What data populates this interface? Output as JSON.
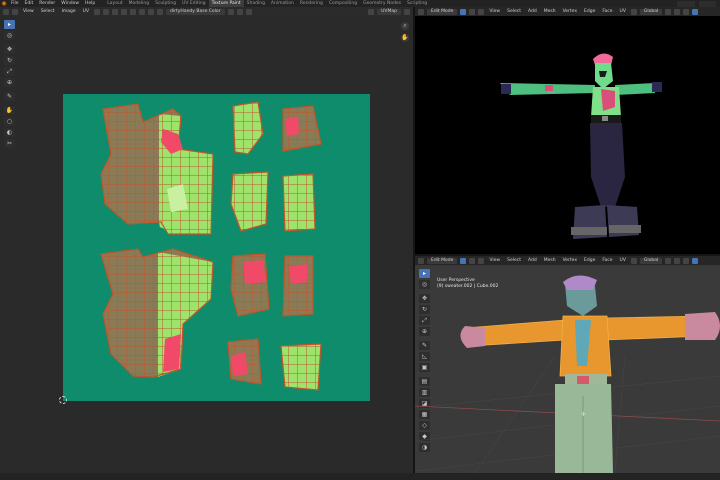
{
  "topbar": {
    "menus": [
      "File",
      "Edit",
      "Render",
      "Window",
      "Help"
    ],
    "tabs": [
      "Layout",
      "Modeling",
      "Sculpting",
      "UV Editing",
      "Texture Paint",
      "Shading",
      "Animation",
      "Rendering",
      "Compositing",
      "Geometry Nodes",
      "Scripting"
    ],
    "active_tab": "Texture Paint"
  },
  "uv_editor": {
    "menus": [
      "View",
      "Select",
      "Image",
      "UV"
    ],
    "image_name": "dirtyHandy Base Color",
    "uv_map": "UVMap",
    "tools": [
      "select",
      "cursor",
      "move",
      "rotate",
      "scale",
      "transform",
      "annotate",
      "grab",
      "relax",
      "pinch",
      "rip"
    ],
    "canvas_color": "#0f8c6b",
    "island_color": "#9ee36b",
    "edge_color": "#c0562c",
    "selected_color": "#f14a68"
  },
  "viewport_top": {
    "mode": "Edit Mode",
    "menus": [
      "View",
      "Select",
      "Add",
      "Mesh",
      "Vertex",
      "Edge",
      "Face",
      "UV"
    ],
    "orientation": "Global"
  },
  "viewport_bottom": {
    "mode": "Edit Mode",
    "menus": [
      "View",
      "Select",
      "Add",
      "Mesh",
      "Vertex",
      "Edge",
      "Face",
      "UV"
    ],
    "orientation": "Global",
    "overlay": {
      "view_name": "User Perspective",
      "object_info": "(9) sweater.002 | Cube.002"
    }
  }
}
